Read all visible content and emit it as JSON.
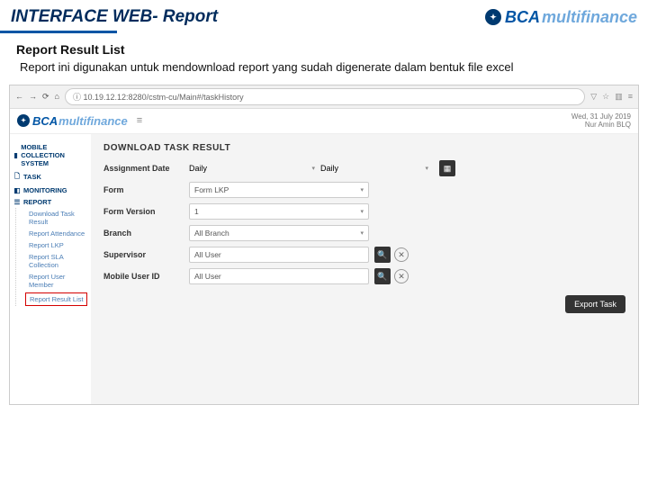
{
  "slide": {
    "title": "INTERFACE WEB- Report",
    "logo_bca": "BCA",
    "logo_mf": "multifinance",
    "subhead": "Report Result List",
    "desc": "Report ini digunakan untuk mendownload report yang sudah digenerate dalam bentuk file excel"
  },
  "browser": {
    "url": "10.19.12.12:8280/cstm-cu/Main#/taskHistory"
  },
  "header": {
    "date": "Wed, 31 July 2019",
    "user": "Nur Amin BLQ"
  },
  "sidebar": {
    "heads": {
      "mobile": "MOBILE COLLECTION SYSTEM",
      "task": "TASK",
      "monitoring": "MONITORING",
      "report": "REPORT"
    },
    "report_items": {
      "download": "Download Task Result",
      "attendance": "Report Attendance",
      "lkp": "Report LKP",
      "sla": "Report SLA Collection",
      "user": "Report User Member",
      "result": "Report Result List"
    }
  },
  "panel": {
    "title": "DOWNLOAD TASK RESULT",
    "labels": {
      "assign": "Assignment Date",
      "form": "Form",
      "version": "Form Version",
      "branch": "Branch",
      "supervisor": "Supervisor",
      "mobile": "Mobile User ID"
    },
    "fields": {
      "assign1": "Daily",
      "assign2": "Daily",
      "form": "Form LKP",
      "version": "1",
      "branch": "All Branch",
      "supervisor": "All User",
      "mobile": "All User"
    },
    "export": "Export Task"
  }
}
